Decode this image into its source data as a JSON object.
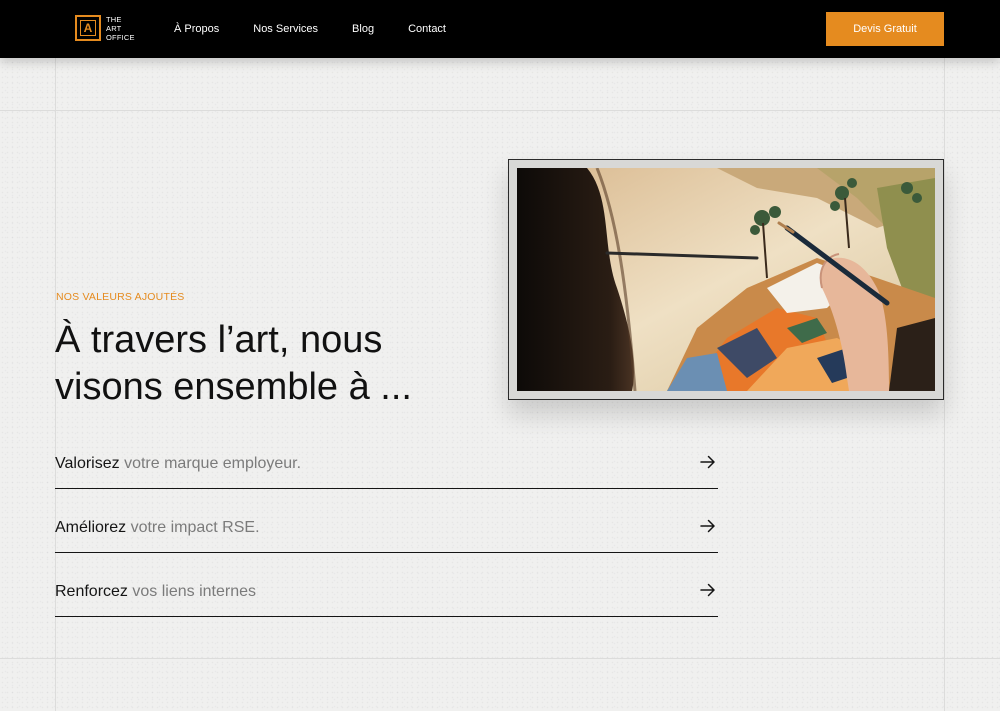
{
  "header": {
    "logo_lines": [
      "THE",
      "ART",
      "OFFICE"
    ],
    "logo_letter": "A",
    "nav": [
      "À Propos",
      "Nos Services",
      "Blog",
      "Contact"
    ],
    "cta_label": "Devis Gratuit"
  },
  "hero": {
    "eyebrow": "NOS VALEURS AJOUTÉS",
    "headline_line1": "À travers l’art, nous",
    "headline_line2": "visons ensemble à ...",
    "values": [
      {
        "strong": "Valorisez",
        "rest": " votre marque employeur."
      },
      {
        "strong": "Améliorez",
        "rest": " votre impact RSE."
      },
      {
        "strong": "Renforcez",
        "rest": " vos liens internes"
      }
    ]
  },
  "colors": {
    "accent": "#e58b1f",
    "header_bg": "#000000",
    "page_bg": "#f0f0ef",
    "text": "#121212",
    "muted_text": "#7b7b7b"
  },
  "icons": {
    "value_arrow": "arrow-right-icon",
    "logo": "logo-icon"
  }
}
